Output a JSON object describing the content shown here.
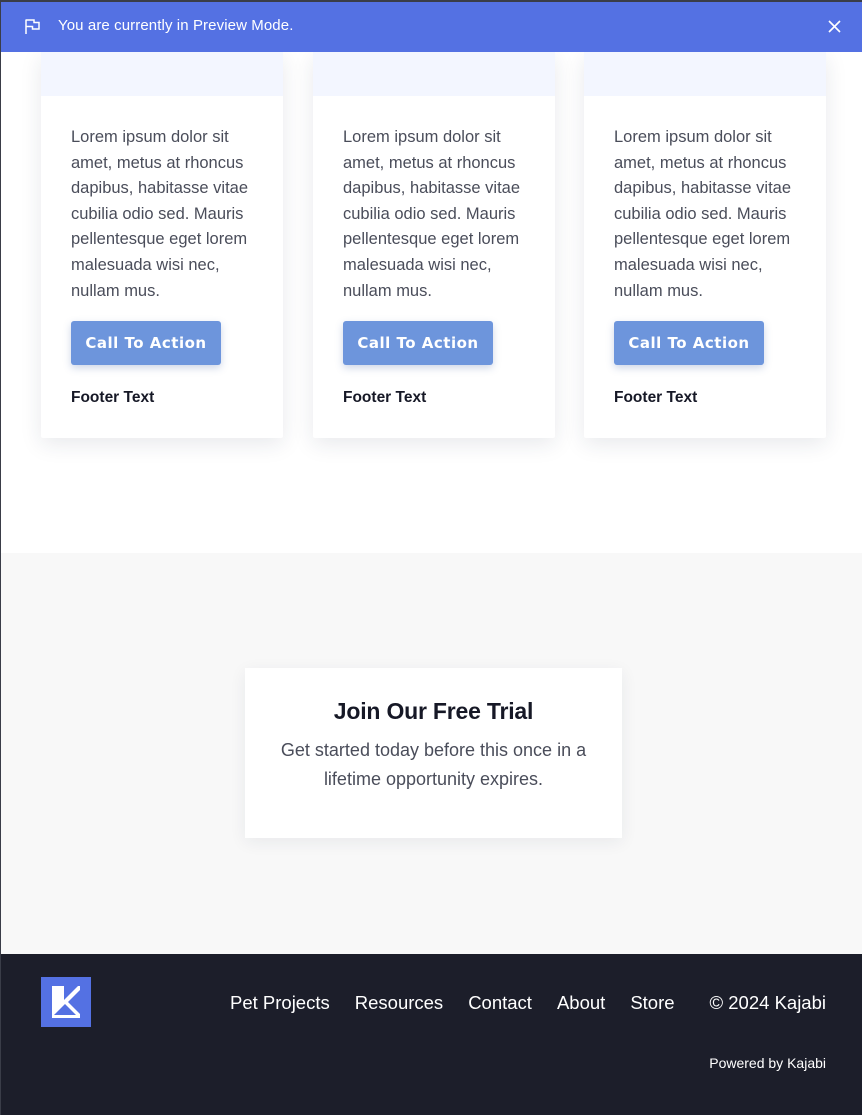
{
  "preview_banner": {
    "message": "You are currently in Preview Mode.",
    "flag_icon": "flag-icon",
    "close_icon": "close-icon",
    "bg_color": "#5471e3"
  },
  "cards": [
    {
      "body": "Lorem ipsum dolor sit amet, metus at rhoncus dapibus, habitasse vitae cubilia odio sed. Mauris pellentesque eget lorem malesuada wisi nec, nullam mus.",
      "cta_label": "Call To Action",
      "footer": "Footer Text"
    },
    {
      "body": "Lorem ipsum dolor sit amet, metus at rhoncus dapibus, habitasse vitae cubilia odio sed. Mauris pellentesque eget lorem malesuada wisi nec, nullam mus.",
      "cta_label": "Call To Action",
      "footer": "Footer Text"
    },
    {
      "body": "Lorem ipsum dolor sit amet, metus at rhoncus dapibus, habitasse vitae cubilia odio sed. Mauris pellentesque eget lorem malesuada wisi nec, nullam mus.",
      "cta_label": "Call To Action",
      "footer": "Footer Text"
    }
  ],
  "trial": {
    "title": "Join Our Free Trial",
    "subtitle": "Get started today before this once in a lifetime opportunity expires."
  },
  "footer": {
    "logo_icon": "kajabi-logo-icon",
    "nav": [
      "Pet Projects",
      "Resources",
      "Contact",
      "About",
      "Store"
    ],
    "copyright": "© 2024 Kajabi",
    "powered_prefix": "Powered by ",
    "powered_link": "Kajabi",
    "bg_color": "#1c1e2a"
  },
  "colors": {
    "accent": "#5471e3",
    "cta": "#6d95dc",
    "section_bg": "#f8f8f8"
  }
}
